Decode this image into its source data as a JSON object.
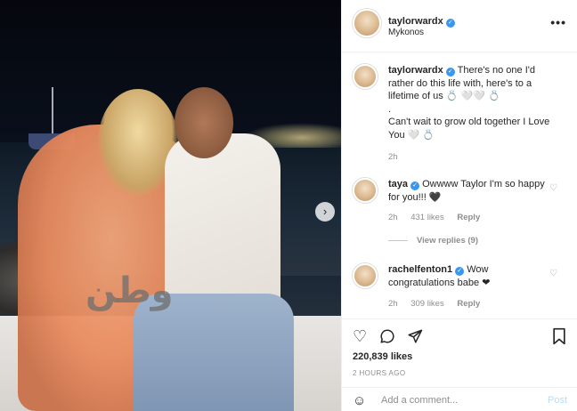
{
  "post_header": {
    "username": "taylorwardx",
    "location": "Mykonos",
    "more": "•••"
  },
  "photo": {
    "watermark": "وطن",
    "next_arrow": "›"
  },
  "caption": {
    "username": "taylorwardx",
    "text_line1": "There's no one I'd rather do this life with, here's to a lifetime of us 💍 🤍🤍 💍",
    "text_line2": ".",
    "text_line3": "Can't wait to grow old together I Love You 🤍 💍",
    "time": "2h"
  },
  "comments": [
    {
      "username": "taya",
      "text": "Owwww Taylor I'm so happy for you!!! 🖤",
      "time": "2h",
      "likes": "431 likes",
      "reply": "Reply",
      "view_replies": "View replies (9)"
    },
    {
      "username": "rachelfenton1",
      "text": "Wow congratulations babe ❤",
      "time": "2h",
      "likes": "309 likes",
      "reply": "Reply"
    }
  ],
  "actions": {
    "likes": "220,839 likes",
    "timestamp": "2 HOURS AGO",
    "add_comment_placeholder": "Add a comment...",
    "post_label": "Post"
  },
  "icons": {
    "like": "heart-icon",
    "comment": "comment-icon",
    "share": "paper-plane-icon",
    "save": "bookmark-icon",
    "emoji": "smiley-icon"
  },
  "colors": {
    "verified_blue": "#3897f0",
    "post_disabled": "#b2dffc",
    "muted_text": "#8e8e8e"
  }
}
